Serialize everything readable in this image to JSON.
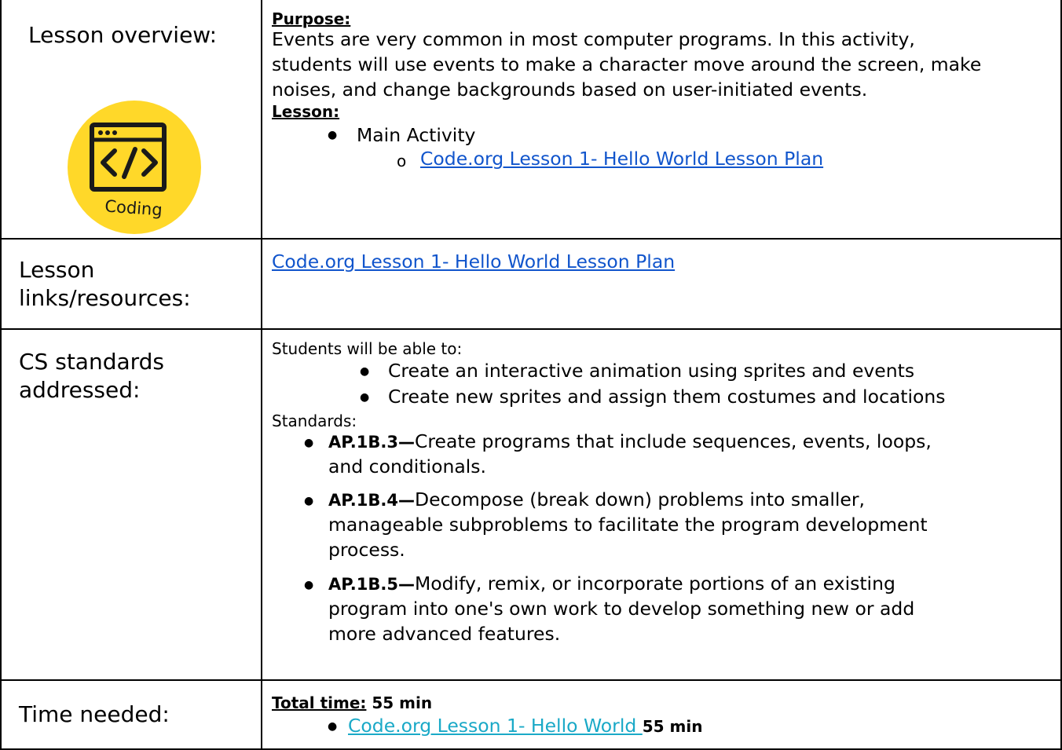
{
  "overview": {
    "label": "Lesson overview:",
    "logo_text": "Coding",
    "purpose_heading": "Purpose:",
    "purpose_text_1": "Events are very common in most computer programs. In this activity,",
    "purpose_text_2": "students will use events to make a character move around the screen, make",
    "purpose_text_3": "noises, and change backgrounds based on user-initiated events.",
    "lesson_heading": "Lesson:",
    "main_activity": "Main Activity",
    "sub_marker": "o",
    "lesson_link": "Code.org Lesson 1- Hello World Lesson Plan"
  },
  "resources": {
    "label_line1": "Lesson",
    "label_line2": "links/resources:",
    "link": "Code.org Lesson 1- Hello World Lesson Plan"
  },
  "standards": {
    "label_line1": "CS standards",
    "label_line2": "addressed:",
    "intro": "Students will be able to:",
    "objectives": [
      "Create an interactive animation using sprites and events",
      "Create new sprites and assign them costumes and locations"
    ],
    "standards_label": "Standards:",
    "items": [
      {
        "code": "AP.1B.3—",
        "lines": [
          "Create programs that include sequences, events, loops,",
          "and conditionals."
        ]
      },
      {
        "code": "AP.1B.4—",
        "lines": [
          "Decompose (break down) problems into smaller,",
          "manageable subproblems to facilitate the program development",
          "process."
        ]
      },
      {
        "code": "AP.1B.5—",
        "lines": [
          "Modify, remix, or incorporate portions of an existing",
          "program into one's own work to develop something new or add",
          "more advanced features."
        ]
      }
    ]
  },
  "time": {
    "label": "Time needed:",
    "total_heading": "Total time:",
    "total_value": "55 min",
    "item_link": "Code.org Lesson 1- Hello World ",
    "item_time": "55 min"
  },
  "colors": {
    "link_blue": "#1155cc",
    "link_teal": "#1aa9c7",
    "logo_yellow": "#ffd829"
  }
}
